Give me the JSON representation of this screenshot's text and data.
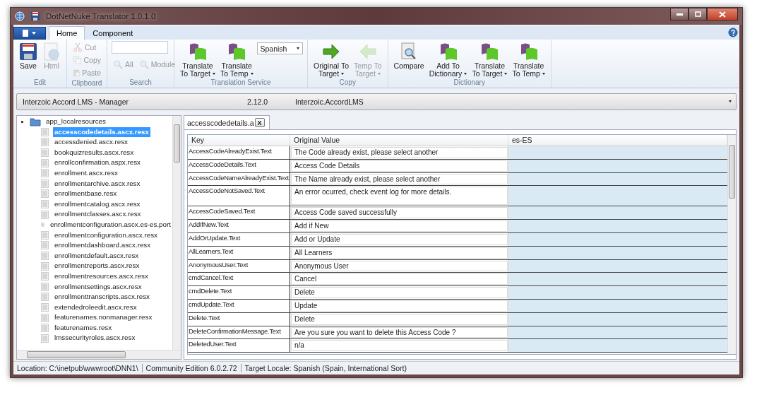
{
  "window": {
    "title": "DotNetNuke Translator 1.0.1.0"
  },
  "ribbon": {
    "tabs": [
      {
        "label": "Home",
        "selected": true
      },
      {
        "label": "Component",
        "selected": false
      }
    ],
    "groups": [
      {
        "label": "Edit",
        "items": [
          {
            "kind": "save",
            "lines": [
              "Save"
            ],
            "disabled": false,
            "dropdown": false
          },
          {
            "kind": "html",
            "lines": [
              "Html"
            ],
            "disabled": true,
            "dropdown": false
          }
        ]
      },
      {
        "label": "Clipboard",
        "items": [
          {
            "kind": "cut",
            "lines": [
              "Cut"
            ],
            "disabled": true
          },
          {
            "kind": "copy",
            "lines": [
              "Copy"
            ],
            "disabled": true
          },
          {
            "kind": "paste",
            "lines": [
              "Paste"
            ],
            "disabled": true
          }
        ]
      },
      {
        "label": "Search",
        "items": [
          {
            "kind": "search-field"
          },
          {
            "kind": "search",
            "lines": [
              "All"
            ],
            "disabled": true
          },
          {
            "kind": "search",
            "lines": [
              "Module"
            ],
            "disabled": true
          }
        ]
      },
      {
        "label": "Translation Service",
        "items": [
          {
            "kind": "flag",
            "lines": [
              "Translate",
              "To Target"
            ],
            "disabled": false,
            "dropdown": true
          },
          {
            "kind": "flag",
            "lines": [
              "Translate",
              "To Temp"
            ],
            "disabled": false,
            "dropdown": true
          },
          {
            "kind": "select",
            "lines": [
              "Spanish"
            ],
            "disabled": false,
            "dropdown": true
          }
        ]
      },
      {
        "label": "Copy",
        "items": [
          {
            "kind": "arrow-right",
            "lines": [
              "Original To",
              "Target"
            ],
            "disabled": false,
            "dropdown": true
          },
          {
            "kind": "arrow-left",
            "lines": [
              "Temp To",
              "Target"
            ],
            "disabled": true,
            "dropdown": true
          }
        ]
      },
      {
        "label": "Dictionary",
        "items": [
          {
            "kind": "compare",
            "lines": [
              "Compare"
            ],
            "disabled": false,
            "dropdown": false
          },
          {
            "kind": "flag",
            "lines": [
              "Add To",
              "Dictionary"
            ],
            "disabled": false,
            "dropdown": true
          },
          {
            "kind": "flag",
            "lines": [
              "Translate",
              "To Target"
            ],
            "disabled": false,
            "dropdown": true
          },
          {
            "kind": "flag",
            "lines": [
              "Translate",
              "To Temp"
            ],
            "disabled": false,
            "dropdown": true
          }
        ]
      }
    ]
  },
  "module_bar": {
    "name": "Interzoic Accord LMS - Manager",
    "version": "2.12.0",
    "package": "Interzoic.AccordLMS"
  },
  "tree": {
    "label": "app_localresources",
    "expanded": true,
    "children": [
      {
        "label": "accesscodedetails.ascx.resx",
        "selected": true
      },
      {
        "label": "accessdenied.ascx.resx",
        "selected": false
      },
      {
        "label": "bookquizresults.ascx.resx",
        "selected": false
      },
      {
        "label": "enrollconfirmation.aspx.resx",
        "selected": false
      },
      {
        "label": "enrollment.ascx.resx",
        "selected": false
      },
      {
        "label": "enrollmentarchive.ascx.resx",
        "selected": false
      },
      {
        "label": "enrollmentbase.resx",
        "selected": false
      },
      {
        "label": "enrollmentcatalog.ascx.resx",
        "selected": false
      },
      {
        "label": "enrollmentclasses.ascx.resx",
        "selected": false
      },
      {
        "label": "enrollmentconfiguration.ascx.es-es.port",
        "selected": false
      },
      {
        "label": "enrollmentconfiguration.ascx.resx",
        "selected": false
      },
      {
        "label": "enrollmentdashboard.ascx.resx",
        "selected": false
      },
      {
        "label": "enrollmentdefault.ascx.resx",
        "selected": false
      },
      {
        "label": "enrollmentreports.ascx.resx",
        "selected": false
      },
      {
        "label": "enrollmentresources.ascx.resx",
        "selected": false
      },
      {
        "label": "enrollmentsettings.ascx.resx",
        "selected": false
      },
      {
        "label": "enrollmenttranscripts.ascx.resx",
        "selected": false
      },
      {
        "label": "extendedroleedit.ascx.resx",
        "selected": false
      },
      {
        "label": "featurenames.nonmanager.resx",
        "selected": false
      },
      {
        "label": "featurenames.resx",
        "selected": false
      },
      {
        "label": "lmssecurityroles.ascx.resx",
        "selected": false
      }
    ]
  },
  "doc_tabs": [
    {
      "label": "accesscodedetails.a",
      "selected": true,
      "close": "X"
    }
  ],
  "table": {
    "columns": [
      "Key",
      "Original Value",
      "es-ES"
    ],
    "rows": [
      {
        "key": "AccessCodeAlreadyExist.Text",
        "original": "The Code already exist, please select another",
        "tall": false
      },
      {
        "key": "AccessCodeDetails.Text",
        "original": "Access Code Details",
        "tall": false
      },
      {
        "key": "AccessCodeNameAlreadyExist.Text",
        "original": "The Name already exist, please select another",
        "tall": false
      },
      {
        "key": "AccessCodeNotSaved.Text",
        "original": "An error ocurred, check event log for more details.",
        "tall": true
      },
      {
        "key": "AccessCodeSaved.Text",
        "original": "Access Code saved successfully",
        "tall": false
      },
      {
        "key": "AddIfNew.Text",
        "original": "Add if New",
        "tall": false
      },
      {
        "key": "AddOrUpdate.Text",
        "original": "Add or Update",
        "tall": false
      },
      {
        "key": "AllLearners.Text",
        "original": "All Learners",
        "tall": false
      },
      {
        "key": "AnonymousUser.Text",
        "original": "Anonymous User",
        "tall": false
      },
      {
        "key": "cmdCancel.Text",
        "original": "Cancel",
        "tall": false
      },
      {
        "key": "cmdDelete.Text",
        "original": "Delete",
        "tall": false
      },
      {
        "key": "cmdUpdate.Text",
        "original": "Update",
        "tall": false
      },
      {
        "key": "Delete.Text",
        "original": "Delete",
        "tall": false
      },
      {
        "key": "DeleteConfirmationMessage.Text",
        "original": "Are you sure you want to delete this Access Code ?",
        "tall": false
      },
      {
        "key": "DeletedUser.Text",
        "original": "n/a",
        "tall": false
      }
    ]
  },
  "status_bar": [
    "Location: C:\\inetpub\\wwwroot\\DNN1\\",
    "Community Edition  6.0.2.72",
    "Target Locale:  Spanish (Spain, International Sort)"
  ]
}
